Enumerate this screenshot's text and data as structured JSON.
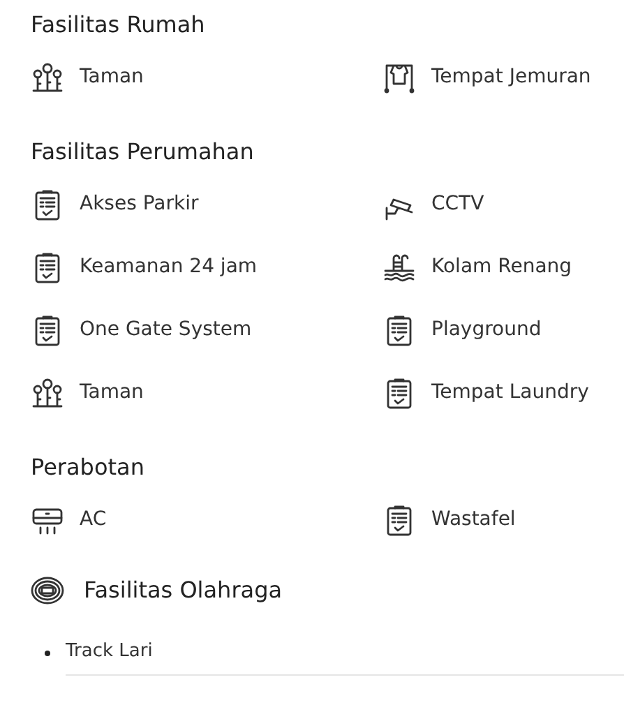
{
  "sections": [
    {
      "title": "Fasilitas Rumah",
      "items": [
        {
          "label": "Taman",
          "kind": "flowers"
        },
        {
          "label": "Tempat Jemuran",
          "kind": "rack"
        }
      ]
    },
    {
      "title": "Fasilitas Perumahan",
      "items": [
        {
          "label": "Akses Parkir",
          "kind": "clipboard"
        },
        {
          "label": "CCTV",
          "kind": "cctv"
        },
        {
          "label": "Keamanan 24 jam",
          "kind": "clipboard"
        },
        {
          "label": "Kolam Renang",
          "kind": "pool"
        },
        {
          "label": "One Gate System",
          "kind": "clipboard"
        },
        {
          "label": "Playground",
          "kind": "clipboard"
        },
        {
          "label": "Taman",
          "kind": "flowers"
        },
        {
          "label": "Tempat Laundry",
          "kind": "clipboard"
        }
      ]
    },
    {
      "title": "Perabotan",
      "items": [
        {
          "label": "AC",
          "kind": "ac"
        },
        {
          "label": "Wastafel",
          "kind": "clipboard"
        }
      ]
    }
  ],
  "sports": {
    "title": "Fasilitas Olahraga",
    "items": [
      "Track Lari"
    ]
  }
}
